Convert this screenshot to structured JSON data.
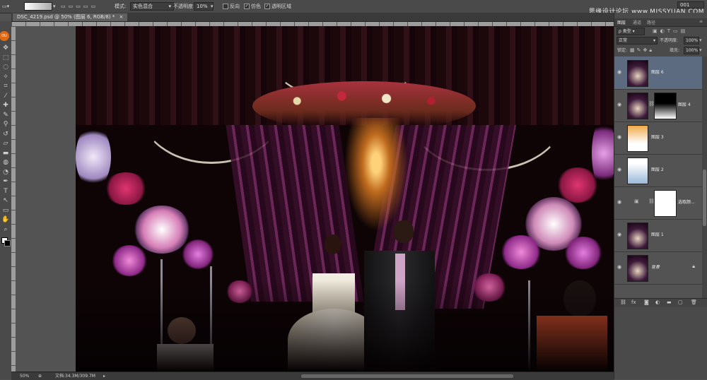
{
  "options_bar": {
    "mode_label": "模式:",
    "mode_value": "实色混合",
    "opacity_label": "不透明度:",
    "opacity_value": "10%",
    "reverse_label": "反向",
    "dither_label": "仿色",
    "transparency_label": "透明区域",
    "reverse_checked": false,
    "dither_checked": true,
    "transparency_checked": true,
    "field_value": "001",
    "watermark": "思缘设计论坛 www.MISSYUAN.COM"
  },
  "document_tab": {
    "title": "DSC_4219.psd @ 50% (图层 6, RGB/8) *"
  },
  "tools": [
    "move-icon",
    "marquee-icon",
    "lasso-icon",
    "magic-wand-icon",
    "crop-icon",
    "eyedropper-icon",
    "healing-icon",
    "brush-icon",
    "clone-stamp-icon",
    "history-brush-icon",
    "eraser-icon",
    "gradient-icon",
    "blur-icon",
    "dodge-icon",
    "pen-icon",
    "type-icon",
    "path-select-icon",
    "shape-icon",
    "hand-icon",
    "zoom-icon"
  ],
  "status_bar": {
    "zoom": "50%",
    "doc_info": "文档:34.3M/309.7M"
  },
  "panels": {
    "tabs": [
      "图层",
      "通道",
      "路径"
    ],
    "kind_filter": "ρ 类型",
    "blend_mode": "正常",
    "opacity_label": "不透明度:",
    "opacity_value": "100%",
    "lock_label": "锁定:",
    "fill_label": "填充:",
    "fill_value": "100%",
    "layers": [
      {
        "name": "图层 6",
        "selected": true,
        "kind": "photo"
      },
      {
        "name": "图层 4",
        "selected": false,
        "kind": "photo-mask"
      },
      {
        "name": "图层 3",
        "selected": false,
        "kind": "orange-gradient"
      },
      {
        "name": "图层 2",
        "selected": false,
        "kind": "blue-gradient"
      },
      {
        "name": "选取颜...",
        "selected": false,
        "kind": "adjustment"
      },
      {
        "name": "图层 1",
        "selected": false,
        "kind": "photo"
      },
      {
        "name": "背景",
        "selected": false,
        "kind": "photo-locked"
      }
    ]
  },
  "colors": {
    "ui_dark": "#4a4a4a",
    "ui_canvas": "#535353",
    "selection": "#5d6b80",
    "ps_badge": "#e06a14"
  }
}
